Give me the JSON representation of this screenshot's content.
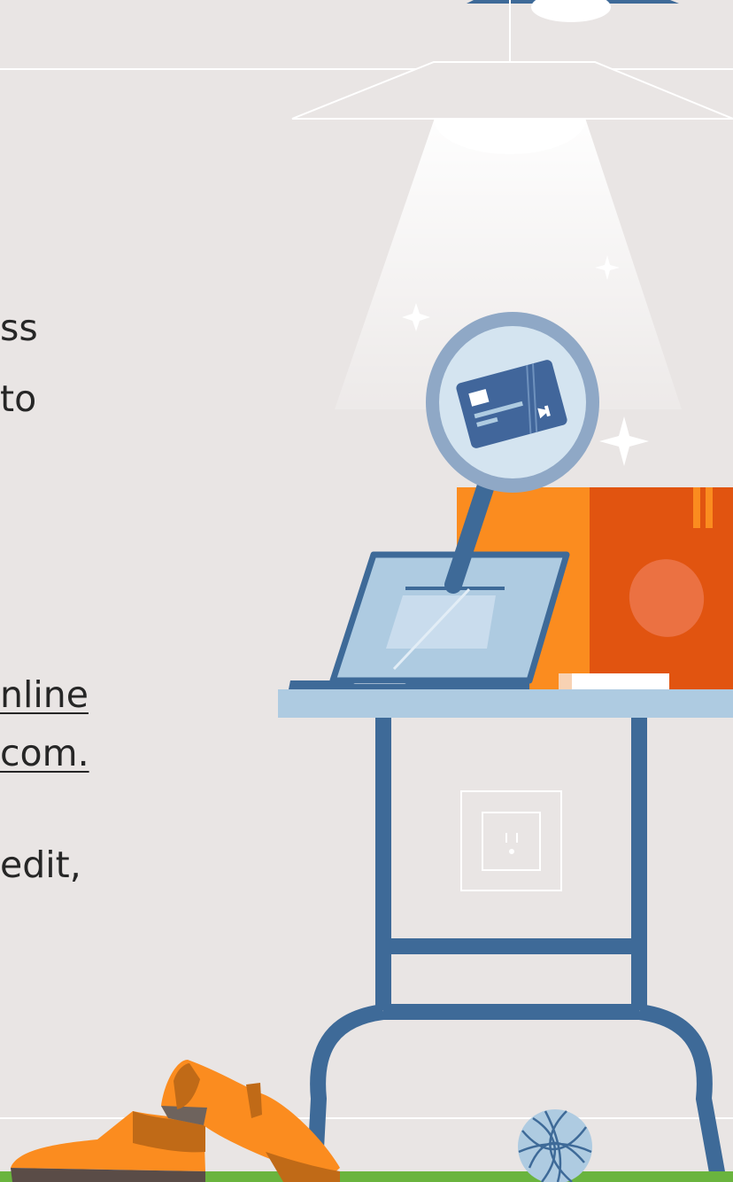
{
  "content": {
    "fragments": [
      {
        "id": "line1",
        "text": "ss"
      },
      {
        "id": "line2",
        "text": " to"
      },
      {
        "id": "line3",
        "text": "nline"
      },
      {
        "id": "line4",
        "text": "com."
      },
      {
        "id": "line5",
        "text": "edit,"
      }
    ]
  },
  "illustration": {
    "icons": [
      "ceiling-lamp-icon",
      "magnifying-glass-icon",
      "credit-card-icon",
      "laptop-icon",
      "shipping-box-icon",
      "side-table-icon",
      "power-outlet-icon",
      "shoes-icon",
      "yarn-ball-icon",
      "sparkle-icon"
    ],
    "colors": {
      "background": "#e9e5e4",
      "navy": "#3e6a98",
      "light_blue": "#aecbe1",
      "orange": "#fb8c1f",
      "dark_orange": "#e15410",
      "grass": "#6ab43e"
    }
  }
}
